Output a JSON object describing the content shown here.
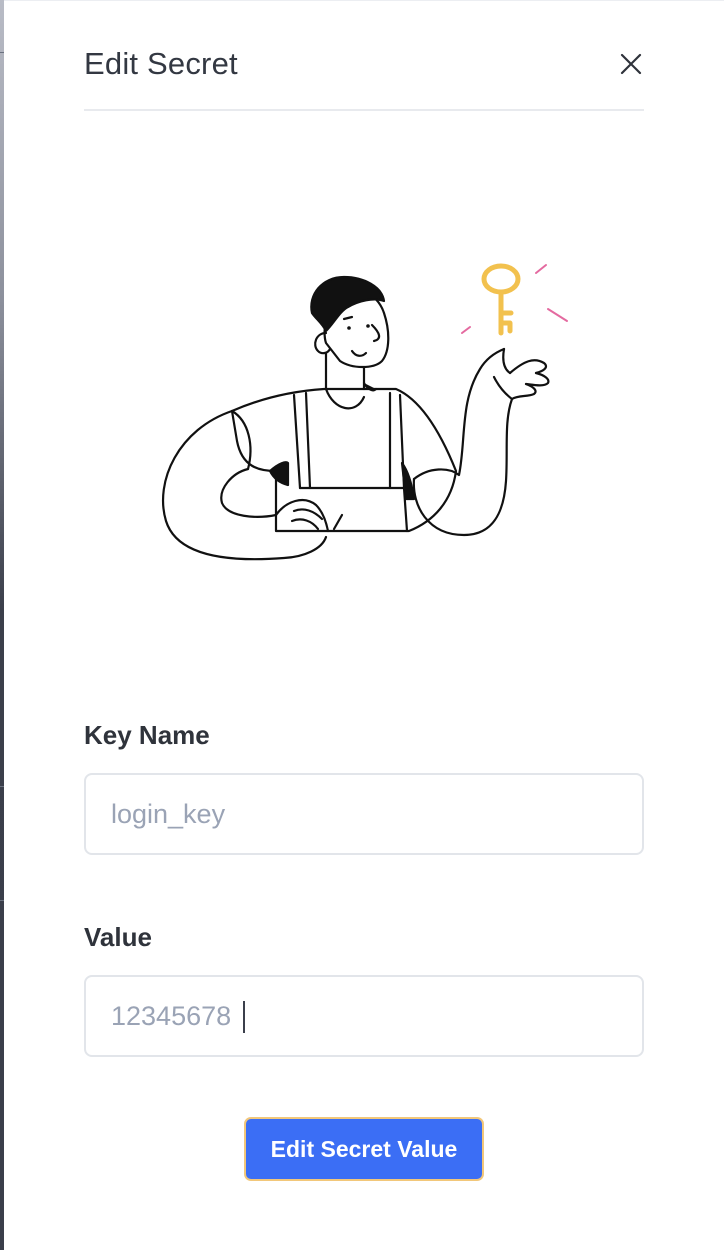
{
  "dialog": {
    "title": "Edit Secret",
    "close_icon": "close-icon"
  },
  "illustration": {
    "subject": "person-presenting-key-illustration",
    "key_icon": "key-icon",
    "accent_color": "#F2C14E",
    "sparkle_color": "#E46AA0"
  },
  "form": {
    "key_name": {
      "label": "Key Name",
      "value": "login_key"
    },
    "value": {
      "label": "Value",
      "value": "12345678"
    },
    "submit_label": "Edit Secret Value"
  },
  "colors": {
    "primary_button": "#3B6EF5",
    "button_focus_ring": "#F2C77A",
    "input_text": "#9AA3B5",
    "input_border": "#E2E5EA"
  }
}
